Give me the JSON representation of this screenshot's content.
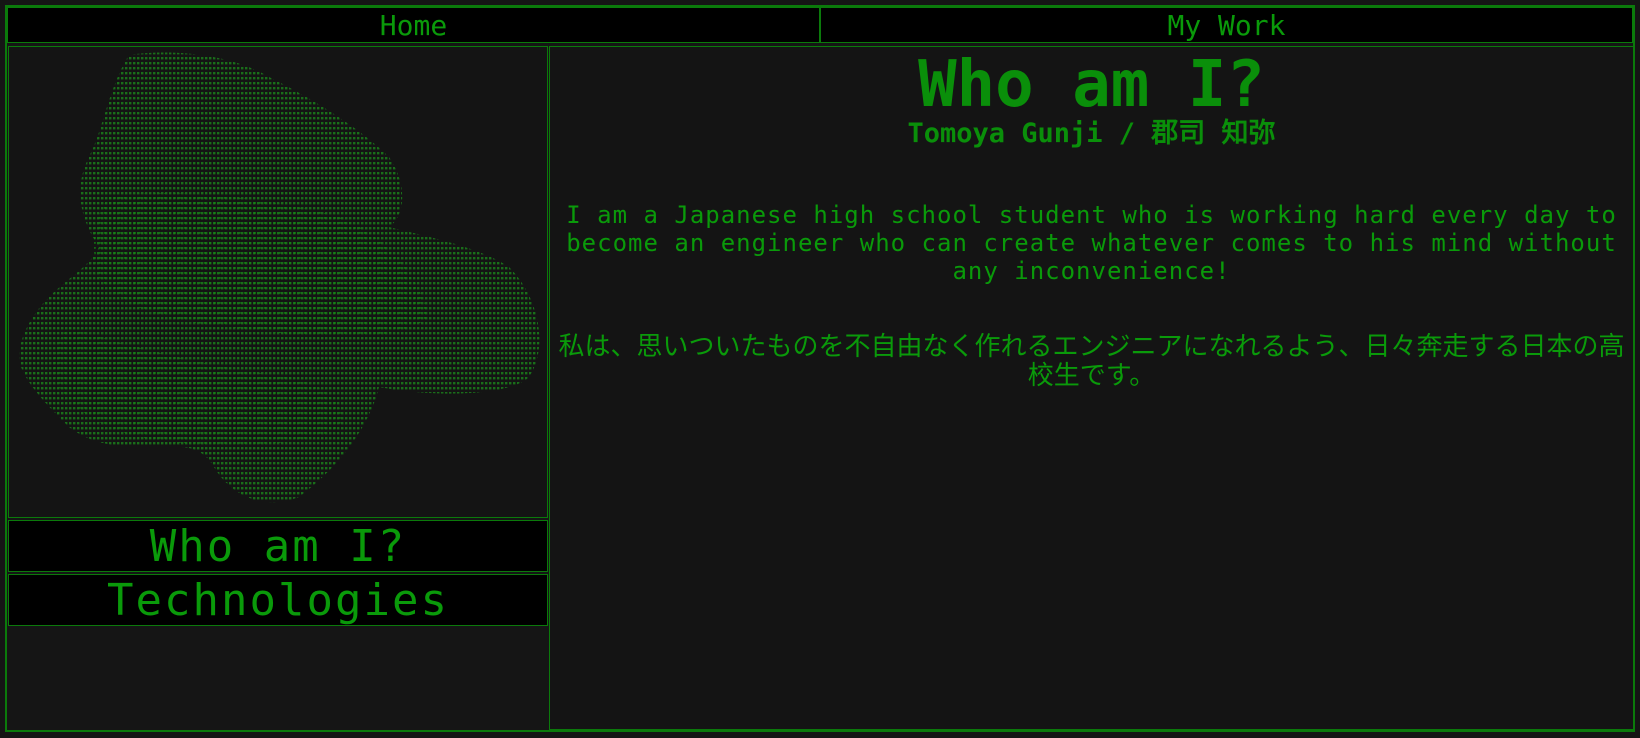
{
  "nav": {
    "home_label": "Home",
    "work_label": "My Work"
  },
  "sidebar": {
    "portrait_alt": "ASCII art portrait",
    "who_label": "Who am I?",
    "tech_label": "Technologies"
  },
  "main": {
    "title": "Who am I?",
    "subtitle": "Tomoya Gunji / 郡司 知弥",
    "paragraph_en": "I am a Japanese high school student who is working hard every day to become an engineer who can create whatever comes to his mind without any inconvenience!",
    "paragraph_ja": "私は、思いついたものを不自由なく作れるエンジニアになれるよう、日々奔走する日本の高校生です。"
  },
  "colors": {
    "accent": "#0a9a0a",
    "border": "#0b7a0b",
    "background": "#151515",
    "nav_background": "#000000"
  }
}
